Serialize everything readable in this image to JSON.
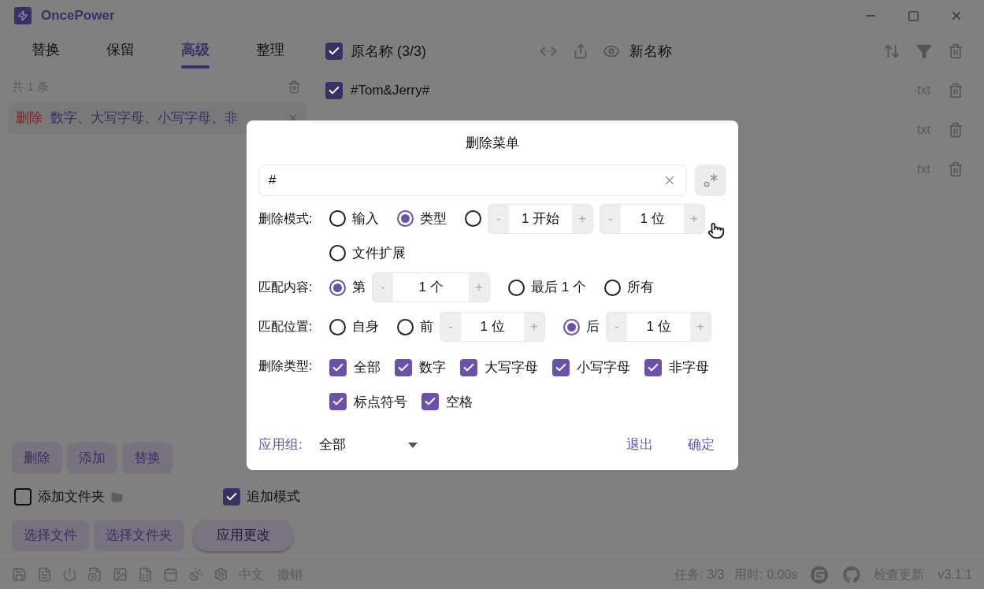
{
  "app": {
    "title": "OncePower"
  },
  "tabs": [
    {
      "label": "替换",
      "selected": false
    },
    {
      "label": "保留",
      "selected": false
    },
    {
      "label": "高级",
      "selected": true
    },
    {
      "label": "整理",
      "selected": false
    }
  ],
  "rules": {
    "count": "共 1 条",
    "items": [
      {
        "action": "删除",
        "text": "数字、大写字母、小写字母、非"
      }
    ]
  },
  "rule_buttons": [
    "删除",
    "添加",
    "替换"
  ],
  "options": [
    {
      "kind": "folder",
      "label": "添加文件夹",
      "checked": false
    },
    {
      "kind": "plain",
      "label": "追加模式",
      "checked": true
    }
  ],
  "file_buttons": [
    "选择文件",
    "选择文件夹"
  ],
  "apply_button": "应用更改",
  "file_list": {
    "header": {
      "checked": true,
      "original": "原名称 (3/3)",
      "new": "新名称"
    },
    "rows": [
      {
        "name": "#Tom&Jerry#",
        "checked": true,
        "ext": "txt"
      },
      {
        "ext": "txt"
      },
      {
        "ext": "txt"
      }
    ]
  },
  "status_bar": {
    "language": "中文",
    "undo": "撤销",
    "tasks": "任务: 3/3",
    "time": "用时: 0.00s",
    "update": "检查更新",
    "version": "v3.1.1"
  },
  "dialog": {
    "title": "删除菜单",
    "input": {
      "value": "#"
    },
    "steppers": {
      "minus": "-",
      "plus": "+"
    },
    "delete_mode": {
      "label": "删除模式:",
      "options": [
        {
          "kind": "radio",
          "label": "输入",
          "selected": false
        },
        {
          "kind": "radio",
          "label": "类型",
          "selected": true
        },
        {
          "kind": "range",
          "selected": false,
          "start": "1 开始",
          "length": "1 位"
        },
        {
          "kind": "radio",
          "label": "文件扩展",
          "selected": false
        }
      ]
    },
    "match_content": {
      "label": "匹配内容:",
      "options": [
        {
          "kind": "counter",
          "label": "第",
          "value": "1 个",
          "selected": true
        },
        {
          "kind": "radio",
          "label": "最后 1 个",
          "selected": false
        },
        {
          "kind": "radio",
          "label": "所有",
          "selected": false
        }
      ]
    },
    "match_position": {
      "label": "匹配位置:",
      "options": [
        {
          "kind": "radio",
          "label": "自身",
          "selected": false
        },
        {
          "kind": "counter",
          "label": "前",
          "value": "1 位",
          "selected": false
        },
        {
          "kind": "counter",
          "label": "后",
          "value": "1 位",
          "selected": true
        }
      ]
    },
    "delete_types": {
      "label": "删除类型:",
      "items": [
        {
          "label": "全部",
          "checked": true
        },
        {
          "label": "数字",
          "checked": true
        },
        {
          "label": "大写字母",
          "checked": true
        },
        {
          "label": "小写字母",
          "checked": true
        },
        {
          "label": "非字母",
          "checked": true
        },
        {
          "label": "标点符号",
          "checked": true
        },
        {
          "label": "空格",
          "checked": true
        }
      ]
    },
    "group": {
      "label": "应用组:",
      "value": "全部"
    },
    "buttons": [
      "退出",
      "确定"
    ]
  }
}
